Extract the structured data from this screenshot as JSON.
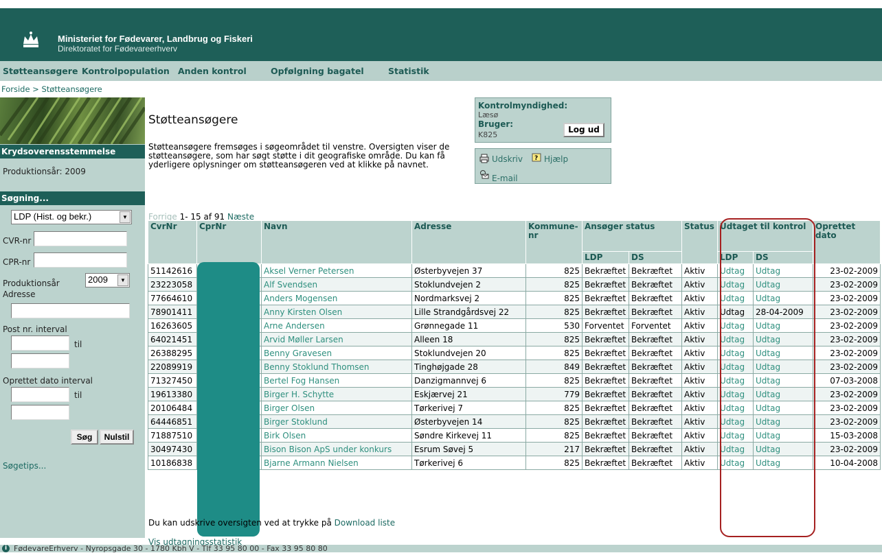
{
  "header": {
    "ministry": "Ministeriet for Fødevarer, Landbrug og Fiskeri",
    "directorate": "Direktoratet for Fødevareerhverv"
  },
  "menu": [
    "Støtteansøgere",
    "Kontrolpopulation",
    "Anden kontrol",
    "Opfølgning bagatel",
    "Statistik"
  ],
  "breadcrumb": "Forside > Støtteansøgere",
  "sidebar": {
    "section1_title": "Krydsoverensstemmelse",
    "production_year_text": "Produktionsår: 2009",
    "section2_title": "Søgning...",
    "type_select": "LDP (Hist. og bekr.)",
    "cvr_label": "CVR-nr",
    "cpr_label": "CPR-nr",
    "year_label": "Produktionsår",
    "year_select": "2009",
    "address_label": "Adresse",
    "post_interval_label": "Post nr. interval",
    "til1": "til",
    "date_interval_label": "Oprettet dato interval",
    "til2": "til",
    "search_button": "Søg",
    "reset_button": "Nulstil",
    "tips_link": "Søgetips..."
  },
  "page": {
    "title": "Støtteansøgere",
    "intro": "Støtteansøgere fremsøges i søgeområdet til venstre. Oversigten viser de støtteansøgere, som har søgt støtte i dit geografiske område. Du kan få yderligere oplysninger om støtteansøgeren ved at klikke på navnet."
  },
  "infobox": {
    "authority_label": "Kontrolmyndighed:",
    "authority_value": "Læsø",
    "user_label": "Bruger:",
    "user_value": "K825",
    "logout": "Log ud"
  },
  "actions": {
    "print": "Udskriv",
    "help": "Hjælp",
    "email": "E-mail"
  },
  "pager": {
    "prev": "Forrige",
    "range": "1- 15 af 91",
    "next": "Næste"
  },
  "table": {
    "headers": {
      "cvr": "CvrNr",
      "cpr": "CprNr",
      "name": "Navn",
      "address": "Adresse",
      "kommune": "Kommune-nr",
      "applicant_status": "Ansøger status",
      "status": "Status",
      "selected": "Udtaget til kontrol",
      "created": "Oprettet dato",
      "ldp": "LDP",
      "ds": "DS",
      "ldp2": "LDP",
      "ds2": "DS"
    },
    "rows": [
      {
        "cvr": "51142616",
        "name": "Aksel Verner Petersen",
        "address": "Østerbyvejen 37",
        "kommune": "825",
        "ldp": "Bekræftet",
        "ds": "Bekræftet",
        "status": "Aktiv",
        "u_ldp": "Udtag",
        "u_ds": "Udtag",
        "created": "23-02-2009"
      },
      {
        "cvr": "23223058",
        "name": "Alf Svendsen",
        "address": "Stoklundvejen 2",
        "kommune": "825",
        "ldp": "Bekræftet",
        "ds": "Bekræftet",
        "status": "Aktiv",
        "u_ldp": "Udtag",
        "u_ds": "Udtag",
        "created": "23-02-2009"
      },
      {
        "cvr": "77664610",
        "name": "Anders Mogensen",
        "address": "Nordmarksvej 2",
        "kommune": "825",
        "ldp": "Bekræftet",
        "ds": "Bekræftet",
        "status": "Aktiv",
        "u_ldp": "Udtag",
        "u_ds": "Udtag",
        "created": "23-02-2009"
      },
      {
        "cvr": "78901411",
        "name": "Anny Kirsten Olsen",
        "address": "Lille Strandgårdsvej 22",
        "kommune": "825",
        "ldp": "Bekræftet",
        "ds": "Bekræftet",
        "status": "Aktiv",
        "u_ldp": "Udtag",
        "u_ds": "28-04-2009",
        "created": "23-02-2009"
      },
      {
        "cvr": "16263605",
        "name": "Arne Andersen",
        "address": "Grønnegade 11",
        "kommune": "530",
        "ldp": "Forventet",
        "ds": "Forventet",
        "status": "Aktiv",
        "u_ldp": "Udtag",
        "u_ds": "Udtag",
        "created": "23-02-2009"
      },
      {
        "cvr": "64021451",
        "name": "Arvid Møller Larsen",
        "address": "Alleen 18",
        "kommune": "825",
        "ldp": "Bekræftet",
        "ds": "Bekræftet",
        "status": "Aktiv",
        "u_ldp": "Udtag",
        "u_ds": "Udtag",
        "created": "23-02-2009"
      },
      {
        "cvr": "26388295",
        "name": "Benny Gravesen",
        "address": "Stoklundvejen 20",
        "kommune": "825",
        "ldp": "Bekræftet",
        "ds": "Bekræftet",
        "status": "Aktiv",
        "u_ldp": "Udtag",
        "u_ds": "Udtag",
        "created": "23-02-2009"
      },
      {
        "cvr": "22089919",
        "name": "Benny Stoklund Thomsen",
        "address": "Tinghøjgade 28",
        "kommune": "849",
        "ldp": "Bekræftet",
        "ds": "Bekræftet",
        "status": "Aktiv",
        "u_ldp": "Udtag",
        "u_ds": "Udtag",
        "created": "23-02-2009"
      },
      {
        "cvr": "71327450",
        "name": "Bertel Fog Hansen",
        "address": "Danzigmannvej 6",
        "kommune": "825",
        "ldp": "Bekræftet",
        "ds": "Bekræftet",
        "status": "Aktiv",
        "u_ldp": "Udtag",
        "u_ds": "Udtag",
        "created": "07-03-2008"
      },
      {
        "cvr": "19613380",
        "name": "Birger H. Schytte",
        "address": "Eskjærvej 21",
        "kommune": "779",
        "ldp": "Bekræftet",
        "ds": "Bekræftet",
        "status": "Aktiv",
        "u_ldp": "Udtag",
        "u_ds": "Udtag",
        "created": "23-02-2009"
      },
      {
        "cvr": "20106484",
        "name": "Birger Olsen",
        "address": "Tørkerivej 7",
        "kommune": "825",
        "ldp": "Bekræftet",
        "ds": "Bekræftet",
        "status": "Aktiv",
        "u_ldp": "Udtag",
        "u_ds": "Udtag",
        "created": "23-02-2009"
      },
      {
        "cvr": "64446851",
        "name": "Birger Stoklund",
        "address": "Østerbyvejen 14",
        "kommune": "825",
        "ldp": "Bekræftet",
        "ds": "Bekræftet",
        "status": "Aktiv",
        "u_ldp": "Udtag",
        "u_ds": "Udtag",
        "created": "23-02-2009"
      },
      {
        "cvr": "71887510",
        "name": "Birk Olsen",
        "address": "Søndre Kirkevej 11",
        "kommune": "825",
        "ldp": "Bekræftet",
        "ds": "Bekræftet",
        "status": "Aktiv",
        "u_ldp": "Udtag",
        "u_ds": "Udtag",
        "created": "15-03-2008"
      },
      {
        "cvr": "30497430",
        "name": "Bison Bison ApS under konkurs",
        "address": "Esrum Søvej 5",
        "kommune": "217",
        "ldp": "Bekræftet",
        "ds": "Bekræftet",
        "status": "Aktiv",
        "u_ldp": "Udtag",
        "u_ds": "Udtag",
        "created": "23-02-2009"
      },
      {
        "cvr": "10186838",
        "name": "Bjarne Armann Nielsen",
        "address": "Tørkerivej 6",
        "kommune": "825",
        "ldp": "Bekræftet",
        "ds": "Bekræftet",
        "status": "Aktiv",
        "u_ldp": "Udtag",
        "u_ds": "Udtag",
        "created": "10-04-2008"
      }
    ]
  },
  "download_text": "Du kan udskrive oversigten ved at trykke på",
  "download_link": "Download liste",
  "stats_link": "Vis udtagningsstatistik",
  "footer": "FødevareErhverv - Nyropsgade 30 - 1780 Kbh V - Tlf 33 95 80 00 - Fax 33 95 80 80",
  "colors": {
    "header": "#1e5f58",
    "menu": "#b9d0cb",
    "sidebar": "#bcd3ce",
    "link": "#2e8f7e",
    "highlight": "#a52020"
  }
}
